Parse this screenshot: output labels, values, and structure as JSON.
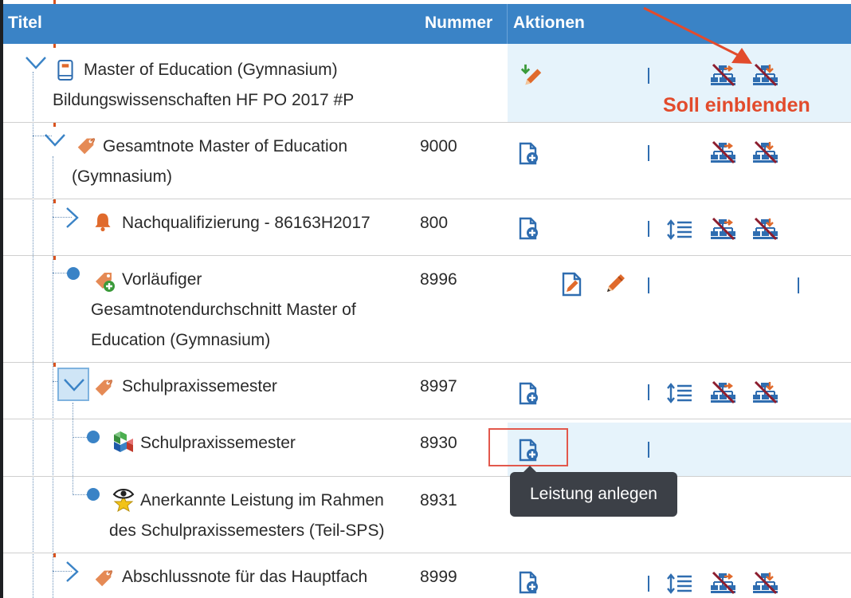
{
  "table": {
    "headers": {
      "title": "Titel",
      "number": "Nummer",
      "actions": "Aktionen"
    },
    "rows": [
      {
        "title_lines": [
          "Master of Education (Gymnasium)",
          "Bildungswissenschaften HF PO 2017 #P"
        ],
        "number": "",
        "icon": "book-icon",
        "toggle": "expanded"
      },
      {
        "title_lines": [
          "Gesamtnote Master of Education",
          "(Gymnasium)"
        ],
        "number": "9000",
        "icon": "tag-icon",
        "toggle": "expanded"
      },
      {
        "title_lines": [
          "Nachqualifizierung - 86163H2017"
        ],
        "number": "800",
        "icon": "bell-icon",
        "toggle": "collapsed"
      },
      {
        "title_lines": [
          "Vorläufiger",
          "Gesamtnotendurchschnitt Master of",
          "Education (Gymnasium)"
        ],
        "number": "8996",
        "icon": "tag-add-icon",
        "toggle": "leaf"
      },
      {
        "title_lines": [
          "Schulpraxissemester"
        ],
        "number": "8997",
        "icon": "tag-icon",
        "toggle": "expanded-selected"
      },
      {
        "title_lines": [
          "Schulpraxissemester"
        ],
        "number": "8930",
        "icon": "blocks-icon",
        "toggle": "leaf"
      },
      {
        "title_lines": [
          "Anerkannte Leistung im Rahmen",
          "des Schulpraxissemesters (Teil-SPS)"
        ],
        "number": "8931",
        "icon": "star-eye-icon",
        "toggle": "leaf"
      },
      {
        "title_lines": [
          "Abschlussnote für das Hauptfach"
        ],
        "number": "8999",
        "icon": "tag-icon",
        "toggle": "collapsed"
      }
    ]
  },
  "tooltip": {
    "text": "Leistung anlegen"
  },
  "annotation": {
    "text": "Soll einblenden",
    "color": "#e24b2c"
  },
  "colors": {
    "header_bg": "#3a83c6",
    "highlight_bg": "#e6f3fb",
    "icon_blue": "#2f6db0",
    "icon_red": "#c0392b",
    "icon_orange": "#e06a2c",
    "icon_green": "#3b9a3a"
  }
}
